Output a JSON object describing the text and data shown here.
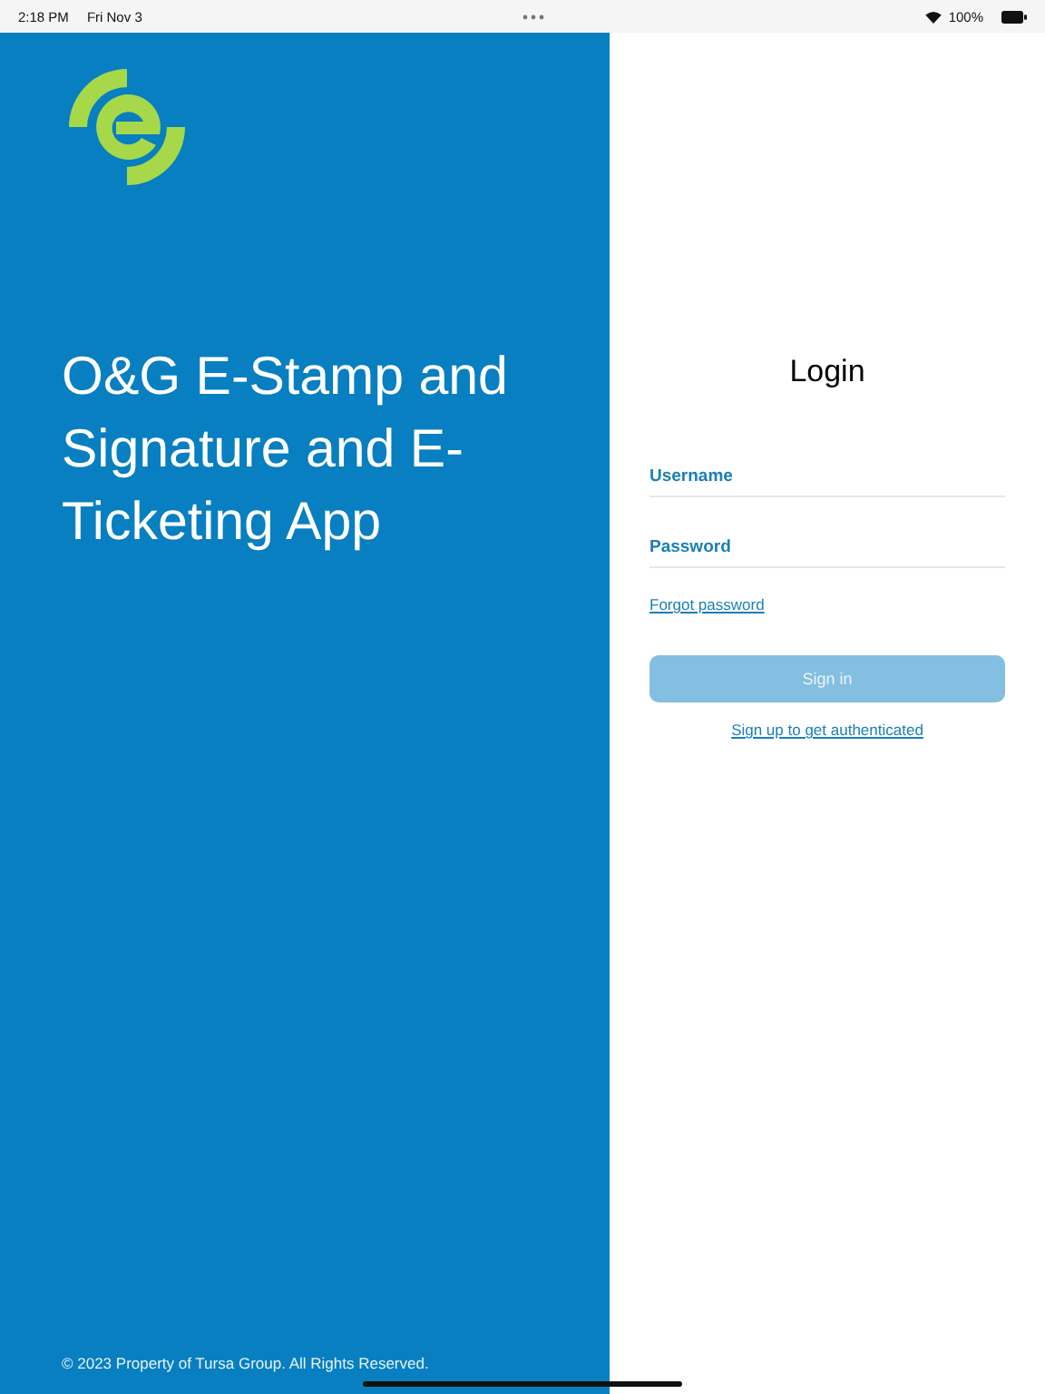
{
  "status_bar": {
    "time": "2:18 PM",
    "date": "Fri Nov 3",
    "battery": "100%"
  },
  "brand_panel": {
    "title_lines": [
      "O&G E-Stamp and",
      "Signature and E-",
      "Ticketing App"
    ],
    "footer": "© 2023 Property of Tursa Group. All Rights Reserved."
  },
  "login": {
    "heading": "Login",
    "fields": [
      {
        "label": "Username"
      },
      {
        "label": "Password"
      }
    ],
    "forgot_link": "Forgot password",
    "sign_in": {
      "label": "Sign in",
      "disabled": true
    },
    "signup_link": "Sign up to get authenticated"
  }
}
